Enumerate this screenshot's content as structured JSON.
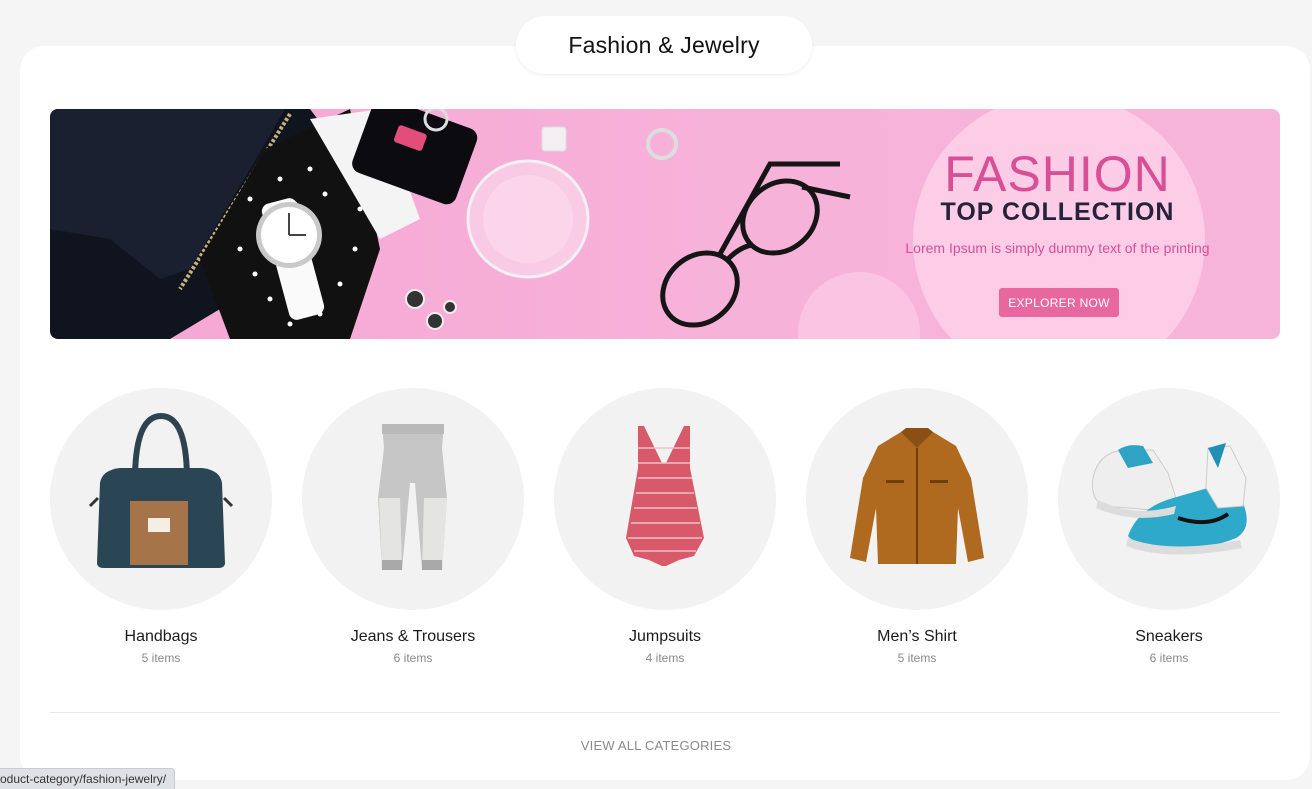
{
  "section": {
    "title": "Fashion & Jewelry"
  },
  "banner": {
    "title": "FASHION",
    "subtitle": "TOP COLLECTION",
    "description": "Lorem Ipsum is simply dummy text of the printing",
    "button_label": "EXPLORER NOW",
    "accent_color": "#d84f96",
    "button_color": "#e8679e"
  },
  "categories": [
    {
      "name": "Handbags",
      "count": "5 items",
      "icon": "handbag-icon"
    },
    {
      "name": "Jeans & Trousers",
      "count": "6 items",
      "icon": "trousers-icon"
    },
    {
      "name": "Jumpsuits",
      "count": "4 items",
      "icon": "jumpsuit-icon"
    },
    {
      "name": "Men’s Shirt",
      "count": "5 items",
      "icon": "jacket-icon"
    },
    {
      "name": "Sneakers",
      "count": "6 items",
      "icon": "sneaker-icon"
    }
  ],
  "footer": {
    "view_all_label": "VIEW ALL CATEGORIES"
  },
  "status_bar": {
    "url": "oduct-category/fashion-jewelry/"
  }
}
